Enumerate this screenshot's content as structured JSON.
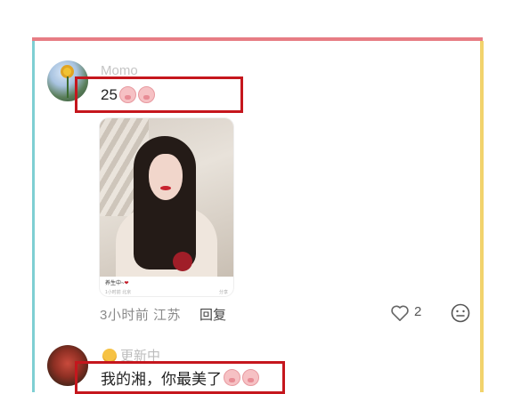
{
  "comment1": {
    "username": "Momo",
    "text": "25",
    "emoji": [
      "pig-face-emoji",
      "pig-face-emoji"
    ],
    "image_caption": "养生中~",
    "image_meta_left": "1小时前 北京",
    "image_meta_right": "分享",
    "time_location": "3小时前 江苏",
    "reply_label": "回复",
    "like_count": "2"
  },
  "comment2": {
    "status_text": "更新中",
    "text": "我的湘，你最美了",
    "emoji": [
      "pig-face-emoji",
      "pig-face-emoji"
    ]
  },
  "colors": {
    "frame_top": "#e77d84",
    "frame_left": "#7fcfd3",
    "frame_right": "#f2d36c",
    "highlight_box": "#c5161d"
  }
}
